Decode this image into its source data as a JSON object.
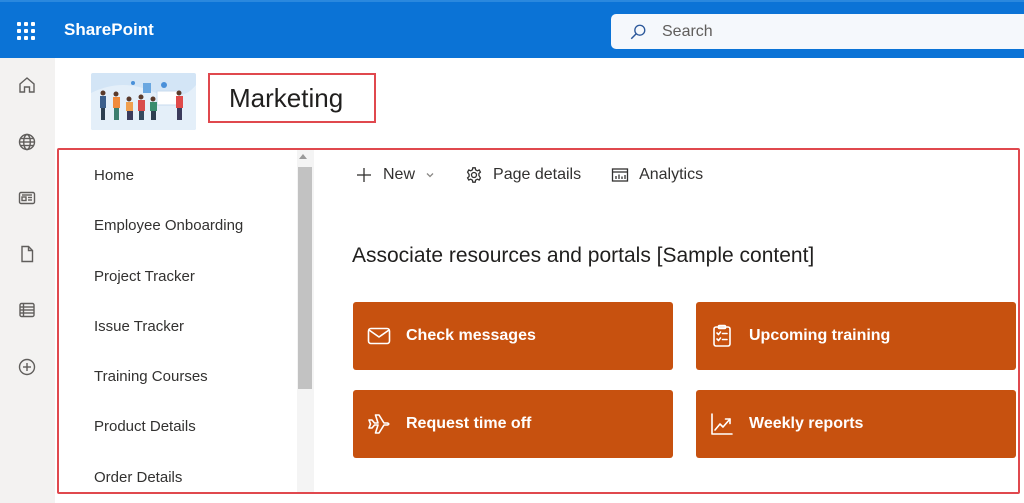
{
  "suite_header": {
    "app_name": "SharePoint",
    "waffle_icon": "app-launcher-icon",
    "search": {
      "placeholder": "Search",
      "value": "",
      "icon": "search-icon"
    }
  },
  "app_rail": {
    "items": [
      {
        "name": "home",
        "icon": "home-icon"
      },
      {
        "name": "sites",
        "icon": "globe-icon"
      },
      {
        "name": "news",
        "icon": "news-icon"
      },
      {
        "name": "files",
        "icon": "document-icon"
      },
      {
        "name": "lists",
        "icon": "list-icon"
      },
      {
        "name": "create",
        "icon": "add-circle-icon"
      }
    ]
  },
  "site": {
    "title": "Marketing",
    "logo": "team-illustration"
  },
  "left_nav": {
    "items": [
      {
        "label": "Home"
      },
      {
        "label": "Employee Onboarding"
      },
      {
        "label": "Project Tracker"
      },
      {
        "label": "Issue Tracker"
      },
      {
        "label": "Training Courses"
      },
      {
        "label": "Product Details"
      },
      {
        "label": "Order Details"
      }
    ]
  },
  "command_bar": {
    "new_label": "New",
    "page_details_label": "Page details",
    "analytics_label": "Analytics"
  },
  "section": {
    "title": "Associate resources and portals [Sample content]",
    "tile_color": "#c7510f",
    "tiles": [
      {
        "label": "Check messages",
        "icon": "mail-icon"
      },
      {
        "label": "Upcoming training",
        "icon": "clipboard-checklist-icon"
      },
      {
        "label": "Request time off",
        "icon": "airplane-icon"
      },
      {
        "label": "Weekly reports",
        "icon": "trending-chart-icon"
      }
    ]
  },
  "colors": {
    "suite_bar": "#0b73d6",
    "highlight": "#e0484e",
    "tile": "#c7510f"
  }
}
